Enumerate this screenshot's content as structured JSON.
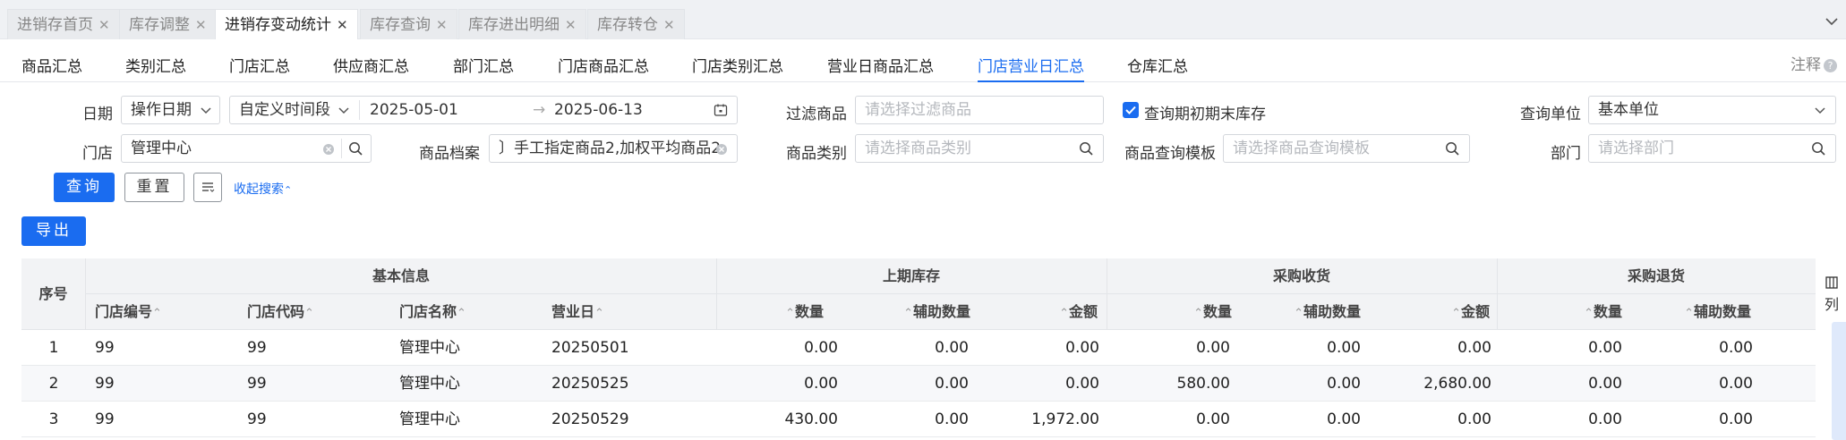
{
  "page_tabs": [
    {
      "label": "进销存首页"
    },
    {
      "label": "库存调整"
    },
    {
      "label": "进销存变动统计"
    },
    {
      "label": "库存查询"
    },
    {
      "label": "库存进出明细"
    },
    {
      "label": "库存转仓"
    }
  ],
  "close_glyph": "✕",
  "sub_tabs": [
    "商品汇总",
    "类别汇总",
    "门店汇总",
    "供应商汇总",
    "部门汇总",
    "门店商品汇总",
    "门店类别汇总",
    "营业日商品汇总",
    "门店营业日汇总",
    "仓库汇总"
  ],
  "note_label": "注释",
  "filters": {
    "date_label": "日期",
    "date_type": "操作日期",
    "period": "自定义时间段",
    "start_date": "2025-05-01",
    "range_sep": "→",
    "end_date": "2025-06-13",
    "filter_goods_label": "过滤商品",
    "filter_goods_placeholder": "请选择过滤商品",
    "query_stock_label": "查询期初期末库存",
    "unit_label": "查询单位",
    "unit_value": "基本单位",
    "store_label": "门店",
    "store_value": "管理中心",
    "goods_file_label": "商品档案",
    "goods_file_value": "〕手工指定商品2,加权平均商品2",
    "category_label": "商品类别",
    "category_placeholder": "请选择商品类别",
    "template_label": "商品查询模板",
    "template_placeholder": "请选择商品查询模板",
    "dept_label": "部门",
    "dept_placeholder": "请选择部门"
  },
  "buttons": {
    "query": "查询",
    "reset": "重置",
    "collapse": "收起搜索",
    "export": "导出"
  },
  "table": {
    "seq_header": "序号",
    "groups": [
      "基本信息",
      "上期库存",
      "采购收货",
      "采购退货"
    ],
    "columns": [
      "门店编号",
      "门店代码",
      "门店名称",
      "营业日",
      "数量",
      "辅助数量",
      "金额",
      "数量",
      "辅助数量",
      "金额",
      "数量",
      "辅助数量"
    ],
    "sort_glyph": "⌃",
    "col_btn": "列",
    "rows": [
      [
        "1",
        "99",
        "99",
        "管理中心",
        "20250501",
        "0.00",
        "0.00",
        "0.00",
        "0.00",
        "0.00",
        "0.00",
        "0.00",
        "0.00"
      ],
      [
        "2",
        "99",
        "99",
        "管理中心",
        "20250525",
        "0.00",
        "0.00",
        "0.00",
        "580.00",
        "0.00",
        "2,680.00",
        "0.00",
        "0.00"
      ],
      [
        "3",
        "99",
        "99",
        "管理中心",
        "20250529",
        "430.00",
        "0.00",
        "1,972.00",
        "0.00",
        "0.00",
        "0.00",
        "0.00",
        "0.00"
      ]
    ]
  },
  "colors": {
    "accent": "#1a6cf0"
  }
}
